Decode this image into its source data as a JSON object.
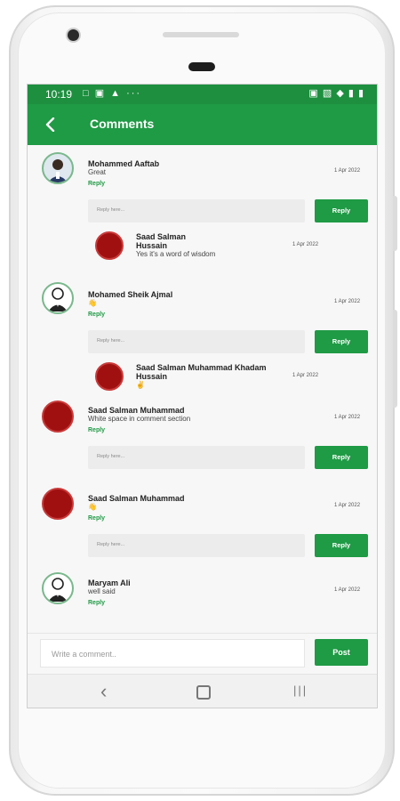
{
  "status": {
    "time": "10:19",
    "left_icons": "□ ▣ ▲  ···",
    "right_icons": "▣ ▧ ◆ ▮ ▮"
  },
  "app": {
    "title": "Comments",
    "back_icon": "arrow-left-icon"
  },
  "reply_placeholder": "Reply here...",
  "reply_button": "Reply",
  "reply_link": "Reply",
  "comments": [
    {
      "author": "Mohammed Aaftab",
      "text": "Great",
      "date": "1 Apr 2022",
      "reply": {
        "author": "Saad Salman\nHussain",
        "text": "Yes it's a word of wisdom",
        "date": "1 Apr 2022"
      }
    },
    {
      "author": "Mohamed Sheik Ajmal",
      "text": "👋",
      "date": "1 Apr 2022",
      "reply": {
        "author": "Saad Salman Muhammad Khadam\nHussain",
        "text": "✌️",
        "date": "1 Apr 2022"
      }
    },
    {
      "author": "Saad Salman Muhammad",
      "text": "White space in comment section",
      "date": "1 Apr 2022"
    },
    {
      "author": "Saad Salman Muhammad",
      "text": "👋",
      "date": "1 Apr 2022"
    },
    {
      "author": "Maryam Ali",
      "text": "well said",
      "date": "1 Apr 2022"
    }
  ],
  "composer": {
    "placeholder": "Write a comment..",
    "post_label": "Post"
  },
  "nav": {
    "back": "‹",
    "recents": "|||"
  },
  "colors": {
    "primary": "#1f9a45",
    "avatar_red": "#a01010"
  }
}
